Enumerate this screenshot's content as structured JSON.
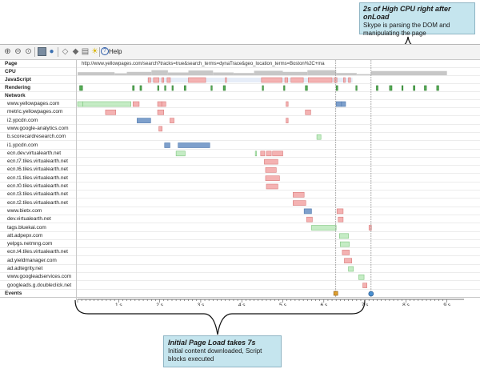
{
  "callout_top": {
    "title": "2s of High CPU right after onLoad",
    "body": "Skype is parsing the DOM and manipulating the page"
  },
  "callout_bottom": {
    "title": "Initial Page Load takes 7s",
    "body": "Initial content downloaded, Script blocks executed"
  },
  "toolbar": {
    "help_label": "Help",
    "icons": [
      "zoom-in-icon",
      "zoom-out-icon",
      "zoom-fit-icon",
      "grid-view-icon",
      "globe-icon",
      "tag-icon",
      "tag-alt-icon",
      "layers-icon",
      "bulb-icon",
      "help-icon"
    ]
  },
  "labels": {
    "page": "Page",
    "cpu": "CPU",
    "javascript": "JavaScript",
    "rendering": "Rendering",
    "network": "Network",
    "events": "Events"
  },
  "page_url": "http://www.yellowpages.com/search?tracks=true&search_terms=dynaTrace&geo_location_terms=Boston%2C+ma",
  "colors": {
    "js": "#f4b2b2",
    "js_border": "#d97c7c",
    "render": "#56ad56",
    "blue": "#7ea0cc",
    "blue_border": "#4d77ad",
    "green": "#c5ecc5",
    "green_border": "#7fc67f",
    "cpu": "#c7c7c7",
    "callout": "#c5e5ee"
  },
  "timeline": {
    "max_s": 9,
    "ticks": [
      "1 s",
      "2 s",
      "3 s",
      "4 s",
      "5 s",
      "6 s",
      "7 s",
      "8 s",
      "9 s"
    ],
    "onload_s": 6.29,
    "end_s": 7.15
  },
  "network": [
    {
      "domain": "www.yellowpages.com",
      "bars": [
        {
          "s": 0.0,
          "e": 0.13,
          "t": "green"
        },
        {
          "s": 0.13,
          "e": 1.3,
          "t": "green"
        },
        {
          "s": 1.35,
          "e": 1.5,
          "t": "red"
        },
        {
          "s": 1.95,
          "e": 2.05,
          "t": "red"
        },
        {
          "s": 2.05,
          "e": 2.15,
          "t": "red"
        },
        {
          "s": 5.08,
          "e": 5.13,
          "t": "red"
        },
        {
          "s": 6.3,
          "e": 6.43,
          "t": "blue"
        },
        {
          "s": 6.43,
          "e": 6.53,
          "t": "blue"
        }
      ]
    },
    {
      "domain": "metric.yellowpages.com",
      "bars": [
        {
          "s": 0.68,
          "e": 0.93,
          "t": "red"
        },
        {
          "s": 1.95,
          "e": 2.1,
          "t": "red"
        },
        {
          "s": 5.55,
          "e": 5.68,
          "t": "red"
        }
      ]
    },
    {
      "domain": "i2.ypcdn.com",
      "bars": [
        {
          "s": 1.45,
          "e": 1.78,
          "t": "blue"
        },
        {
          "s": 2.25,
          "e": 2.35,
          "t": "red"
        },
        {
          "s": 5.08,
          "e": 5.13,
          "t": "red"
        }
      ]
    },
    {
      "domain": "www.google-analytics.com",
      "bars": [
        {
          "s": 1.98,
          "e": 2.06,
          "t": "red"
        }
      ]
    },
    {
      "domain": "b.scorecardresearch.com",
      "bars": [
        {
          "s": 5.83,
          "e": 5.93,
          "t": "green"
        }
      ]
    },
    {
      "domain": "i1.ypcdn.com",
      "bars": [
        {
          "s": 2.12,
          "e": 2.25,
          "t": "blue"
        },
        {
          "s": 2.45,
          "e": 3.22,
          "t": "blue"
        }
      ]
    },
    {
      "domain": "ecn.dev.virtualearth.net",
      "bars": [
        {
          "s": 2.4,
          "e": 2.62,
          "t": "green"
        },
        {
          "s": 4.33,
          "e": 4.36,
          "t": "green"
        },
        {
          "s": 4.46,
          "e": 4.56,
          "t": "red"
        },
        {
          "s": 4.6,
          "e": 4.72,
          "t": "red"
        },
        {
          "s": 4.75,
          "e": 5.0,
          "t": "red"
        }
      ]
    },
    {
      "domain": "ecn.t7.tiles.virtualearth.net",
      "bars": [
        {
          "s": 4.55,
          "e": 4.88,
          "t": "red"
        }
      ]
    },
    {
      "domain": "ecn.t6.tiles.virtualearth.net",
      "bars": [
        {
          "s": 4.58,
          "e": 4.84,
          "t": "red"
        }
      ]
    },
    {
      "domain": "ecn.t1.tiles.virtualearth.net",
      "bars": [
        {
          "s": 4.58,
          "e": 4.92,
          "t": "red"
        }
      ]
    },
    {
      "domain": "ecn.t0.tiles.virtualearth.net",
      "bars": [
        {
          "s": 4.6,
          "e": 4.88,
          "t": "red"
        }
      ]
    },
    {
      "domain": "ecn.t3.tiles.virtualearth.net",
      "bars": [
        {
          "s": 5.25,
          "e": 5.52,
          "t": "red"
        }
      ]
    },
    {
      "domain": "ecn.t2.tiles.virtualearth.net",
      "bars": [
        {
          "s": 5.25,
          "e": 5.56,
          "t": "red"
        }
      ]
    },
    {
      "domain": "www.bietx.com",
      "bars": [
        {
          "s": 5.52,
          "e": 5.7,
          "t": "blue"
        },
        {
          "s": 6.32,
          "e": 6.47,
          "t": "red"
        }
      ]
    },
    {
      "domain": "dev.virtualearth.net",
      "bars": [
        {
          "s": 5.58,
          "e": 5.72,
          "t": "red"
        },
        {
          "s": 6.35,
          "e": 6.47,
          "t": "red"
        }
      ]
    },
    {
      "domain": "tags.bluekai.com",
      "bars": [
        {
          "s": 5.7,
          "e": 6.3,
          "t": "green"
        },
        {
          "s": 7.1,
          "e": 7.16,
          "t": "red"
        }
      ]
    },
    {
      "domain": "att.adpepx.com",
      "bars": [
        {
          "s": 6.38,
          "e": 6.6,
          "t": "green"
        }
      ]
    },
    {
      "domain": "yelpgs.netmng.com",
      "bars": [
        {
          "s": 6.4,
          "e": 6.62,
          "t": "green"
        }
      ]
    },
    {
      "domain": "ecn.t4.tiles.virtualearth.net",
      "bars": [
        {
          "s": 6.45,
          "e": 6.62,
          "t": "red"
        }
      ]
    },
    {
      "domain": "ad.yieldmanager.com",
      "bars": [
        {
          "s": 6.5,
          "e": 6.68,
          "t": "red"
        }
      ]
    },
    {
      "domain": "ad.adtegrity.net",
      "bars": [
        {
          "s": 6.6,
          "e": 6.72,
          "t": "green"
        }
      ]
    },
    {
      "domain": "www.googleadservices.com",
      "bars": [
        {
          "s": 6.85,
          "e": 6.98,
          "t": "green"
        }
      ]
    },
    {
      "domain": "googleads.g.doubleclick.net",
      "bars": [
        {
          "s": 6.95,
          "e": 7.05,
          "t": "red"
        }
      ]
    }
  ],
  "javascript_bars": [
    {
      "s": 1.72,
      "e": 1.78
    },
    {
      "s": 1.85,
      "e": 1.98
    },
    {
      "s": 2.05,
      "e": 2.1
    },
    {
      "s": 2.18,
      "e": 2.26
    },
    {
      "s": 2.7,
      "e": 3.12
    },
    {
      "s": 3.6,
      "e": 3.62
    },
    {
      "s": 4.48,
      "e": 4.98
    },
    {
      "s": 5.05,
      "e": 5.12
    },
    {
      "s": 5.2,
      "e": 5.5
    },
    {
      "s": 5.62,
      "e": 6.2
    },
    {
      "s": 6.25,
      "e": 6.32
    },
    {
      "s": 6.48,
      "e": 6.52
    },
    {
      "s": 6.6,
      "e": 6.65
    }
  ],
  "rendering_bars": [
    {
      "s": 0.05,
      "e": 0.12
    },
    {
      "s": 1.34,
      "e": 1.38
    },
    {
      "s": 1.52,
      "e": 1.56
    },
    {
      "s": 1.95,
      "e": 1.98
    },
    {
      "s": 2.12,
      "e": 2.15
    },
    {
      "s": 2.3,
      "e": 2.33
    },
    {
      "s": 2.6,
      "e": 2.64
    },
    {
      "s": 3.25,
      "e": 3.28
    },
    {
      "s": 3.55,
      "e": 3.6
    },
    {
      "s": 4.5,
      "e": 4.53
    },
    {
      "s": 5.02,
      "e": 5.05
    },
    {
      "s": 5.55,
      "e": 5.6
    },
    {
      "s": 6.3,
      "e": 6.34
    },
    {
      "s": 6.78,
      "e": 6.8
    },
    {
      "s": 7.28,
      "e": 7.32
    },
    {
      "s": 7.6,
      "e": 7.66
    },
    {
      "s": 7.9,
      "e": 7.93
    },
    {
      "s": 8.18,
      "e": 8.22
    },
    {
      "s": 8.45,
      "e": 8.5
    },
    {
      "s": 8.75,
      "e": 8.8
    }
  ],
  "cpu_levels": [
    {
      "s": 0.0,
      "e": 0.9,
      "v": 0.55
    },
    {
      "s": 0.9,
      "e": 1.2,
      "v": 0.35
    },
    {
      "s": 1.2,
      "e": 1.8,
      "v": 0.6
    },
    {
      "s": 1.8,
      "e": 2.2,
      "v": 0.9
    },
    {
      "s": 2.2,
      "e": 2.7,
      "v": 0.5
    },
    {
      "s": 2.7,
      "e": 3.3,
      "v": 0.85
    },
    {
      "s": 3.3,
      "e": 3.8,
      "v": 0.5
    },
    {
      "s": 3.8,
      "e": 4.3,
      "v": 0.4
    },
    {
      "s": 4.3,
      "e": 5.0,
      "v": 0.8
    },
    {
      "s": 5.0,
      "e": 5.6,
      "v": 0.6
    },
    {
      "s": 5.6,
      "e": 6.3,
      "v": 0.9
    },
    {
      "s": 6.3,
      "e": 6.8,
      "v": 0.4
    },
    {
      "s": 6.8,
      "e": 7.15,
      "v": 0.2
    },
    {
      "s": 7.15,
      "e": 9.0,
      "v": 0.75
    }
  ],
  "events": [
    {
      "name": "dom-ready-event-icon",
      "s": 6.29
    },
    {
      "name": "onload-event-icon",
      "s": 7.15
    }
  ]
}
